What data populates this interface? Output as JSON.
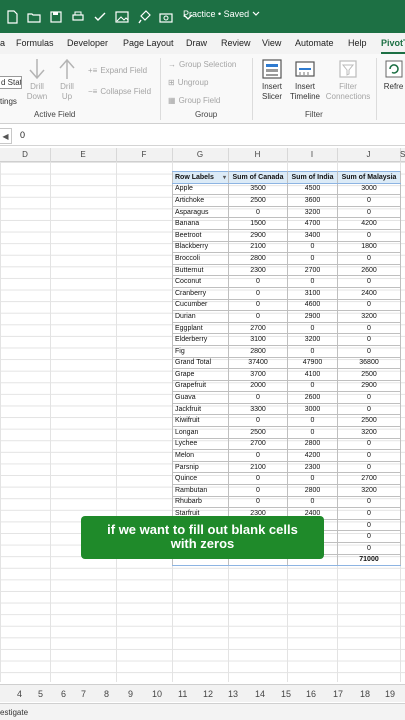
{
  "title": {
    "text": "Practice • Saved",
    "chevron": "chevron-down-icon"
  },
  "menu": {
    "tabs": [
      "a",
      "Formulas",
      "Developer",
      "Page Layout",
      "Draw",
      "Review",
      "View",
      "Automate",
      "Help",
      "PivotT"
    ],
    "active": "PivotT"
  },
  "ribbon": {
    "field_stat": "d Stat",
    "field_settings": "tings",
    "drill_down": "Drill",
    "drill_down2": "Down",
    "drill_up": "Drill",
    "drill_up2": "Up",
    "expand_field": "Expand Field",
    "collapse_field": "Collapse Field",
    "active_field": "Active Field",
    "group_selection": "Group Selection",
    "ungroup": "Ungroup",
    "group_field": "Group Field",
    "group": "Group",
    "insert_slicer": "Insert",
    "insert_slicer2": "Slicer",
    "insert_timeline": "Insert",
    "insert_timeline2": "Timeline",
    "filter_connections": "Filter",
    "filter_connections2": "Connections",
    "filter": "Filter",
    "refresh": "Refre"
  },
  "formula": {
    "cell_value": "0",
    "box": "◀"
  },
  "columns": [
    "D",
    "E",
    "F",
    "G",
    "H",
    "I",
    "J",
    "S"
  ],
  "pivot": {
    "headers": [
      "Row Labels",
      "Sum of Canada",
      "Sum of India",
      "Sum of Malaysia"
    ],
    "rows": [
      [
        "Apple",
        "3500",
        "4500",
        "3000"
      ],
      [
        "Artichoke",
        "2500",
        "3600",
        "0"
      ],
      [
        "Asparagus",
        "0",
        "3200",
        "0"
      ],
      [
        "Banana",
        "1500",
        "4700",
        "4200"
      ],
      [
        "Beetroot",
        "2900",
        "3400",
        "0"
      ],
      [
        "Blackberry",
        "2100",
        "0",
        "1800"
      ],
      [
        "Broccoli",
        "2800",
        "0",
        "0"
      ],
      [
        "Butternut",
        "2300",
        "2700",
        "2600"
      ],
      [
        "Coconut",
        "0",
        "0",
        "0"
      ],
      [
        "Cranberry",
        "0",
        "3100",
        "2400"
      ],
      [
        "Cucumber",
        "0",
        "4600",
        "0"
      ],
      [
        "Durian",
        "0",
        "2900",
        "3200"
      ],
      [
        "Eggplant",
        "2700",
        "0",
        "0"
      ],
      [
        "Elderberry",
        "3100",
        "3200",
        "0"
      ],
      [
        "Fig",
        "2800",
        "0",
        "0"
      ],
      [
        "Grand Total",
        "37400",
        "47900",
        "36800"
      ],
      [
        "Grape",
        "3700",
        "4100",
        "2500"
      ],
      [
        "Grapefruit",
        "2000",
        "0",
        "2900"
      ],
      [
        "Guava",
        "0",
        "2600",
        "0"
      ],
      [
        "Jackfruit",
        "3300",
        "3000",
        "0"
      ],
      [
        "Kiwifruit",
        "0",
        "0",
        "2500"
      ],
      [
        "Longan",
        "2500",
        "0",
        "3200"
      ],
      [
        "Lychee",
        "2700",
        "2800",
        "0"
      ],
      [
        "Melon",
        "0",
        "4200",
        "0"
      ],
      [
        "Parsnip",
        "2100",
        "2300",
        "0"
      ],
      [
        "Quince",
        "0",
        "0",
        "2700"
      ],
      [
        "Rambutan",
        "0",
        "2800",
        "3200"
      ],
      [
        "Rhubarb",
        "0",
        "0",
        "0"
      ],
      [
        "Starfruit",
        "2300",
        "2400",
        "0"
      ],
      [
        "",
        "",
        "",
        "0"
      ],
      [
        "",
        "",
        "",
        "0"
      ],
      [
        "",
        "",
        "",
        "0"
      ]
    ],
    "total": [
      "",
      "",
      "",
      "71000"
    ]
  },
  "caption": {
    "line1": "if we want to fill out blank cells",
    "line2": "with zeros"
  },
  "row_numbers": [
    "4",
    "5",
    "6",
    "7",
    "8",
    "9",
    "10",
    "11",
    "12",
    "13",
    "14",
    "15",
    "16",
    "17",
    "18",
    "19"
  ],
  "status": {
    "text": "estigate"
  },
  "colors": {
    "excel_green": "#1d7044",
    "caption_green": "#1f8a2a",
    "pivot_header": "#dcebf7"
  }
}
